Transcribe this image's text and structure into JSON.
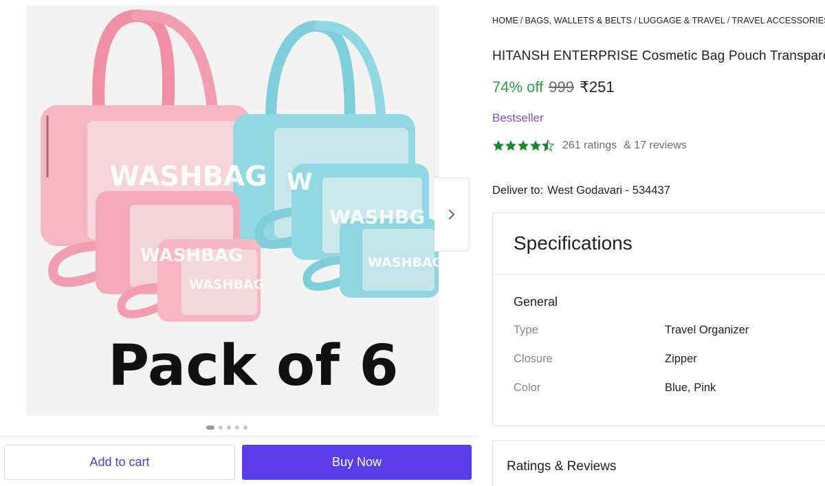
{
  "gallery": {
    "image_text": {
      "big": "WASHBAG",
      "pack_label": "Pack of 6"
    },
    "dots": 5,
    "active_dot": 1,
    "colors": {
      "pink": "#f5a9b8",
      "blue": "#8fd6e0",
      "background": "#f3f3f3"
    }
  },
  "actions": {
    "add_to_cart": "Add to cart",
    "buy_now": "Buy Now"
  },
  "breadcrumb": [
    "HOME",
    "BAGS, WALLETS & BELTS",
    "LUGGAGE & TRAVEL",
    "TRAVEL ACCESSORIES"
  ],
  "breadcrumb_sep": "/",
  "product": {
    "title": "HITANSH ENTERPRISE Cosmetic Bag Pouch Transparent",
    "discount": "74% off",
    "mrp": "999",
    "price": "₹251",
    "badge": "Bestseller",
    "rating_stars": 4.5,
    "ratings_text": "261 ratings",
    "reviews_text": "& 17 reviews"
  },
  "delivery": {
    "label": "Deliver to:",
    "location": "West Godavari - 534437"
  },
  "specifications": {
    "heading": "Specifications",
    "group": "General",
    "rows": [
      {
        "key": "Type",
        "value": "Travel Organizer"
      },
      {
        "key": "Closure",
        "value": "Zipper"
      },
      {
        "key": "Color",
        "value": "Blue, Pink"
      }
    ]
  },
  "ratings_section": {
    "heading": "Ratings & Reviews"
  },
  "theme": {
    "green": "#26a541",
    "purple": "#7a4fc7",
    "buy_button": "#5a3ce8",
    "cart_text": "#4a3fd6"
  }
}
